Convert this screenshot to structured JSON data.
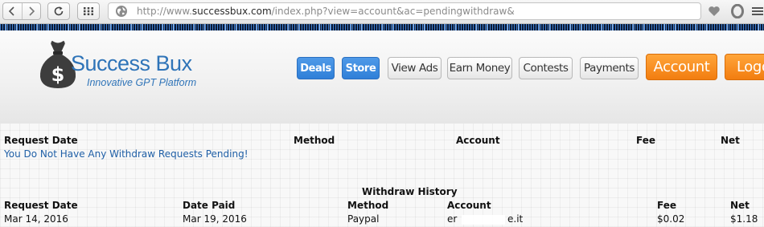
{
  "browser": {
    "url_prefix": "http://www.",
    "url_domain": "successbux.com",
    "url_path": "/index.php?view=account&ac=pendingwithdraw&"
  },
  "site": {
    "logo_title": "Success Bux",
    "logo_tagline": "Innovative GPT Platform",
    "logo_symbol": "$",
    "colors": {
      "accent_blue": "#2f74b8",
      "button_blue": "#2f7fd8",
      "button_orange": "#f27d10"
    }
  },
  "nav": {
    "deals": "Deals",
    "store": "Store",
    "view_ads": "View Ads",
    "earn_money": "Earn Money",
    "contests": "Contests",
    "payments": "Payments",
    "account": "Account",
    "logout": "Logo"
  },
  "pending": {
    "headers": {
      "request_date": "Request Date",
      "method": "Method",
      "account": "Account",
      "fee": "Fee",
      "net": "Net"
    },
    "empty_message": "You Do Not Have Any Withdraw Requests Pending!"
  },
  "history": {
    "title": "Withdraw History",
    "headers": {
      "request_date": "Request Date",
      "date_paid": "Date Paid",
      "method": "Method",
      "account": "Account",
      "fee": "Fee",
      "net": "Net"
    },
    "rows": [
      {
        "request_date": "Mar 14, 2016",
        "date_paid": "Mar 19, 2016",
        "method": "Paypal",
        "account_start": "er",
        "account_end": "e.it",
        "fee": "$0.02",
        "net": "$1.18"
      }
    ]
  }
}
